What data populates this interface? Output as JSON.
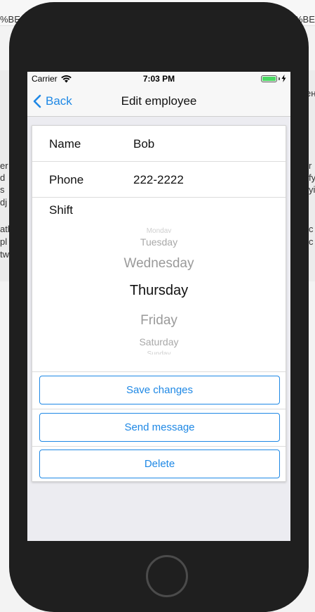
{
  "status_bar": {
    "carrier": "Carrier",
    "time": "7:03 PM"
  },
  "nav": {
    "back_label": "Back",
    "title": "Edit employee"
  },
  "form": {
    "name": {
      "label": "Name",
      "value": "Bob"
    },
    "phone": {
      "label": "Phone",
      "value": "222-2222"
    },
    "shift": {
      "label": "Shift",
      "options": [
        "Monday",
        "Tuesday",
        "Wednesday",
        "Thursday",
        "Friday",
        "Saturday",
        "Sunday"
      ],
      "selected": "Thursday"
    }
  },
  "actions": {
    "save_label": "Save changes",
    "message_label": "Send message",
    "delete_label": "Delete"
  },
  "colors": {
    "accent": "#1e88e5",
    "battery": "#4cd964",
    "device": "#1f1f1f"
  },
  "background_fragments": [
    "%BE",
    "%BE",
    "er",
    "d",
    "s",
    "dj",
    "ath",
    "pl",
    "tw",
    "r",
    "fy",
    "yi",
    "c",
    "c",
    "ен"
  ]
}
